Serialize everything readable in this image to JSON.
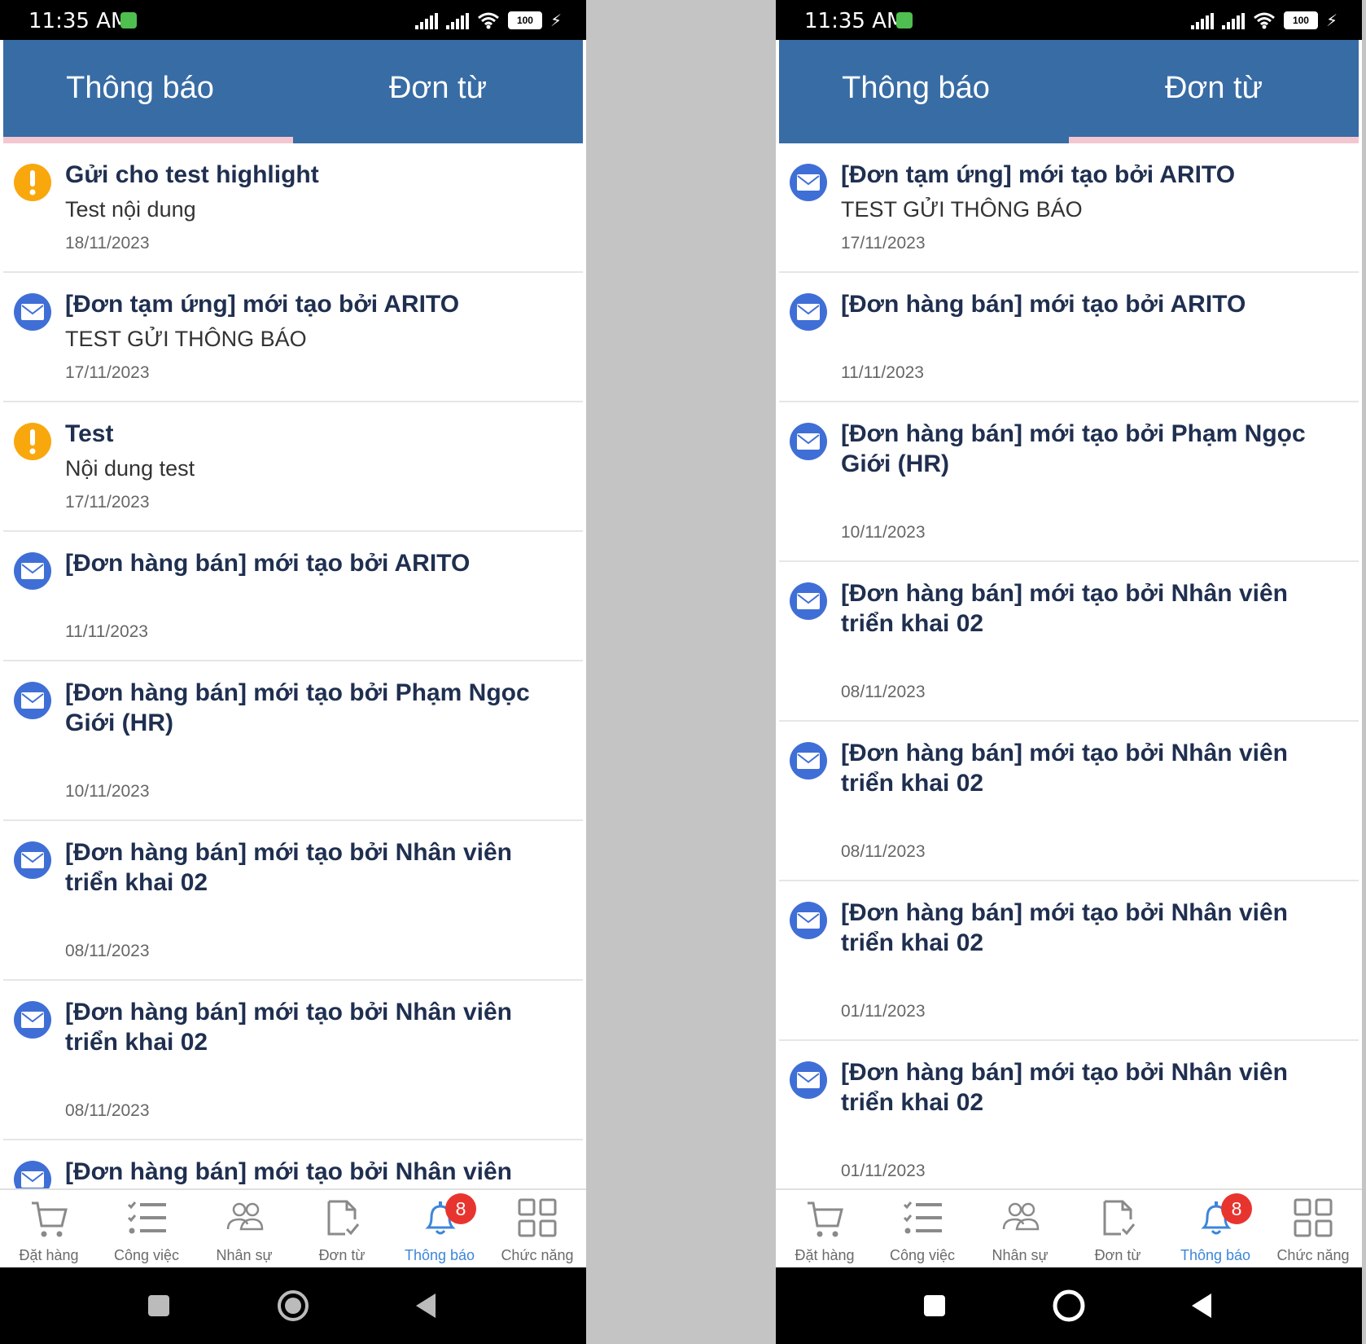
{
  "colors": {
    "appbar": "#386ca5",
    "indicator": "#f4c7d0",
    "title": "#1f2f50",
    "alert": "#f8a80d",
    "mail": "#3f6fd6",
    "badge": "#e8342f",
    "active_nav": "#3d86d9"
  },
  "status": {
    "time": "11:35 AM",
    "battery": "100"
  },
  "tabs": [
    "Thông báo",
    "Đơn từ"
  ],
  "nav": {
    "items": [
      {
        "label": "Đặt hàng",
        "icon": "cart-icon"
      },
      {
        "label": "Công việc",
        "icon": "task-list-icon"
      },
      {
        "label": "Nhân sự",
        "icon": "people-icon"
      },
      {
        "label": "Đơn từ",
        "icon": "document-icon"
      },
      {
        "label": "Thông báo",
        "icon": "bell-icon"
      },
      {
        "label": "Chức năng",
        "icon": "grid-icon"
      }
    ],
    "badge": "8"
  },
  "screens": [
    {
      "active_tab": 0,
      "items": [
        {
          "icon": "alert-icon",
          "title": "Gửi cho test highlight",
          "content": "Test nội dung",
          "date": "18/11/2023"
        },
        {
          "icon": "mail-icon",
          "title": "[Đơn tạm ứng] mới tạo bởi ARITO",
          "content": "TEST GỬI THÔNG BÁO",
          "date": "17/11/2023"
        },
        {
          "icon": "alert-icon",
          "title": "Test",
          "content": "Nội dung test",
          "date": "17/11/2023"
        },
        {
          "icon": "mail-icon",
          "title": "[Đơn hàng bán] mới tạo bởi ARITO",
          "content": "",
          "date": "11/11/2023"
        },
        {
          "icon": "mail-icon",
          "title": "[Đơn hàng bán] mới tạo bởi Phạm Ngọc Giới (HR)",
          "content": "",
          "date": "10/11/2023"
        },
        {
          "icon": "mail-icon",
          "title": "[Đơn hàng bán] mới tạo bởi Nhân viên triển khai 02",
          "content": "",
          "date": "08/11/2023"
        },
        {
          "icon": "mail-icon",
          "title": "[Đơn hàng bán] mới tạo bởi Nhân viên triển khai 02",
          "content": "",
          "date": "08/11/2023"
        },
        {
          "icon": "mail-icon",
          "title": "[Đơn hàng bán] mới tạo bởi Nhân viên triển",
          "content": "",
          "date": ""
        }
      ]
    },
    {
      "active_tab": 1,
      "items": [
        {
          "icon": "mail-icon",
          "title": "[Đơn tạm ứng] mới tạo bởi ARITO",
          "content": "TEST GỬI THÔNG BÁO",
          "date": "17/11/2023"
        },
        {
          "icon": "mail-icon",
          "title": "[Đơn hàng bán] mới tạo bởi ARITO",
          "content": "",
          "date": "11/11/2023"
        },
        {
          "icon": "mail-icon",
          "title": "[Đơn hàng bán] mới tạo bởi Phạm Ngọc Giới (HR)",
          "content": "",
          "date": "10/11/2023"
        },
        {
          "icon": "mail-icon",
          "title": "[Đơn hàng bán] mới tạo bởi Nhân viên triển khai 02",
          "content": "",
          "date": "08/11/2023"
        },
        {
          "icon": "mail-icon",
          "title": "[Đơn hàng bán] mới tạo bởi Nhân viên triển khai 02",
          "content": "",
          "date": "08/11/2023"
        },
        {
          "icon": "mail-icon",
          "title": "[Đơn hàng bán] mới tạo bởi Nhân viên triển khai 02",
          "content": "",
          "date": "01/11/2023"
        },
        {
          "icon": "mail-icon",
          "title": "[Đơn hàng bán] mới tạo bởi Nhân viên triển khai 02",
          "content": "",
          "date": "01/11/2023"
        }
      ]
    }
  ]
}
